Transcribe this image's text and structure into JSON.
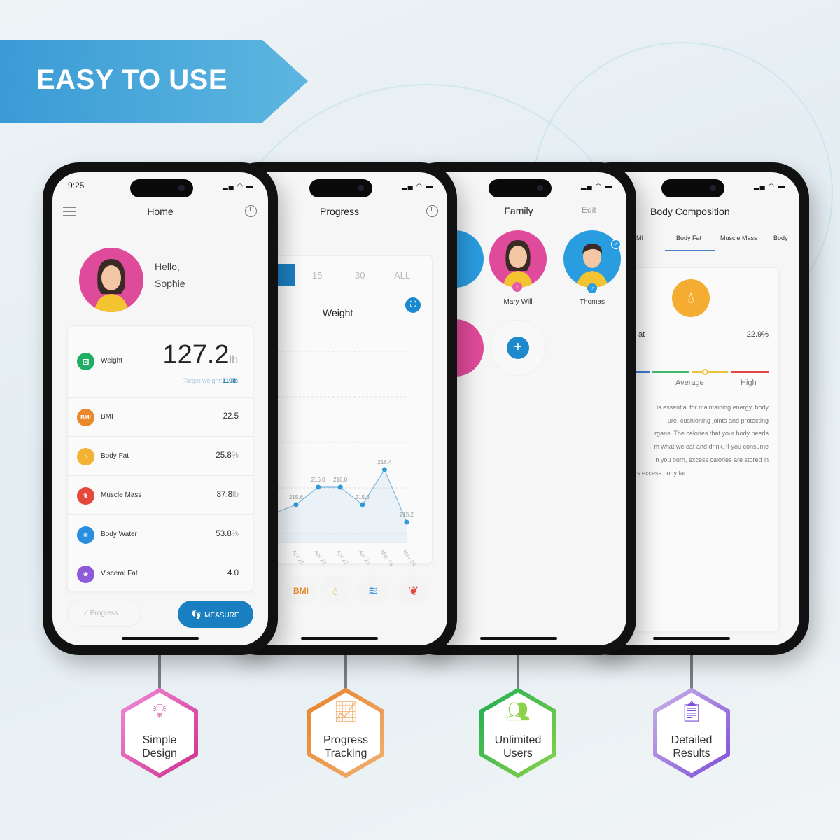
{
  "banner": {
    "title": "EASY TO USE",
    "color": "#3c9fd6"
  },
  "home": {
    "status_time": "9:25",
    "title": "Home",
    "greeting": "Hello,",
    "user_name": "Sophie",
    "weight": {
      "label": "Weight",
      "value": "127.2",
      "unit": "lb",
      "target_label": "Target weight:",
      "target_value": "110lb"
    },
    "metrics": [
      {
        "label": "BMI",
        "value": "22.5",
        "unit": "",
        "icon": "bmi-icon",
        "color": "#e8882a",
        "icon_text": "BMI"
      },
      {
        "label": "Body Fat",
        "value": "25.8",
        "unit": "%",
        "icon": "droplet-icon",
        "color": "#f2b233"
      },
      {
        "label": "Muscle Mass",
        "value": "87.8",
        "unit": "lb",
        "icon": "muscle-icon",
        "color": "#e4473c"
      },
      {
        "label": "Body Water",
        "value": "53.8",
        "unit": "%",
        "icon": "water-icon",
        "color": "#2a8ee0"
      },
      {
        "label": "Visceral Fat",
        "value": "4.0",
        "unit": "",
        "icon": "lungs-icon",
        "color": "#8d5ad8"
      }
    ],
    "progress_button": "Progress",
    "measure_button": "MEASURE",
    "accent": "#1a7fc0"
  },
  "progress": {
    "title": "Progress",
    "tabs": [
      "15",
      "30",
      "ALL"
    ],
    "chart_title": "Weight",
    "bottom_icons": [
      {
        "icon": "bmi-icon",
        "text": "BMI"
      },
      {
        "icon": "droplet-icon"
      },
      {
        "icon": "water-icon"
      },
      {
        "icon": "muscle-icon"
      }
    ]
  },
  "chart_data": {
    "type": "line",
    "title": "Weight",
    "categories": [
      "Apr 21",
      "Apr 23",
      "Apr 23",
      "Apr 23",
      "May 03",
      "May 09"
    ],
    "values": [
      215.6,
      216.0,
      216.0,
      215.6,
      216.4,
      215.2
    ],
    "data_labels": [
      "215.6",
      "216.0",
      "216.0",
      "215.6",
      "216.4",
      "215.2"
    ],
    "grid": true,
    "color": "#2e9ad8"
  },
  "family": {
    "title": "Family",
    "edit": "Edit",
    "members": [
      {
        "name": "Mary Will",
        "gender": "female"
      },
      {
        "name": "Thomas",
        "gender": "male"
      }
    ]
  },
  "composition": {
    "title": "Body Composition",
    "tabs": [
      "MI",
      "Body Fat",
      "Muscle Mass",
      "Body"
    ],
    "metric_label": "at",
    "metric_value": "22.9%",
    "scale_labels": [
      "Average",
      "High"
    ],
    "scale_level": "Average",
    "description": [
      "is essential for maintaining energy, body",
      "ure, cushioning joints and protecting",
      "rgans. The calories that your body needs",
      "m what we eat and drink. If you consume",
      "n you burn, excess calories are stored in",
      "s excess body fat."
    ]
  },
  "features": [
    {
      "line1": "Simple",
      "line2": "Design",
      "icon": "lightbulb-icon",
      "colors": [
        "#f08ad8",
        "#d0308e"
      ]
    },
    {
      "line1": "Progress",
      "line2": "Tracking",
      "icon": "growth-chart-icon",
      "colors": [
        "#e8832a",
        "#f0b070"
      ]
    },
    {
      "line1": "Unlimited",
      "line2": "Users",
      "icon": "users-icon",
      "colors": [
        "#1fae54",
        "#8ad24a"
      ]
    },
    {
      "line1": "Detailed",
      "line2": "Results",
      "icon": "clipboard-check-icon",
      "colors": [
        "#c9b2e6",
        "#7e4fd8"
      ]
    }
  ]
}
